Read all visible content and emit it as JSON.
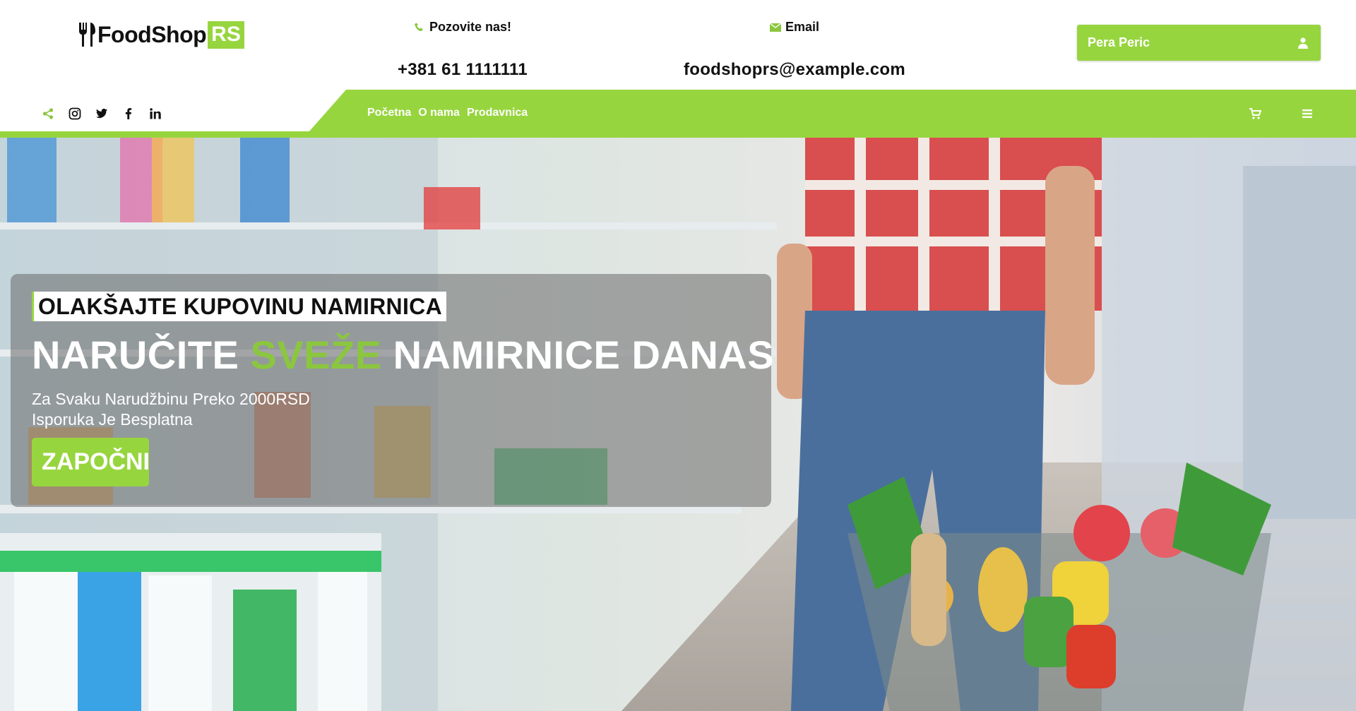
{
  "brand": {
    "name": "FoodShop",
    "suffix": "RS"
  },
  "contact": {
    "phone_label": "Pozovite nas!",
    "phone_value": "+381 61 1111111",
    "email_label": "Email",
    "email_value": "foodshoprs@example.com"
  },
  "user": {
    "name": "Pera Peric",
    "icon": "user-icon"
  },
  "social": [
    "share-icon",
    "instagram-icon",
    "twitter-icon",
    "facebook-icon",
    "linkedin-icon"
  ],
  "nav": {
    "items": [
      "Početna",
      "O nama",
      "Prodavnica"
    ],
    "cart_icon": "cart-icon",
    "menu_icon": "menu-bars-icon"
  },
  "hero": {
    "tagline": "OLAKŠAJTE KUPOVINU NAMIRNICA",
    "title_part1": "NARUČITE",
    "title_accent": "SVEŽE",
    "title_part2": "NAMIRNICE DANAS",
    "subtitle_line1": "Za Svaku Narudžbinu Preko 2000RSD",
    "subtitle_line2": "Isporuka Je Besplatna",
    "cta_label": "ZAPOČNI",
    "cta_icon": "basket-icon"
  },
  "colors": {
    "accent": "#97d53f",
    "title_accent": "#8bc63f",
    "text": "#111111"
  }
}
